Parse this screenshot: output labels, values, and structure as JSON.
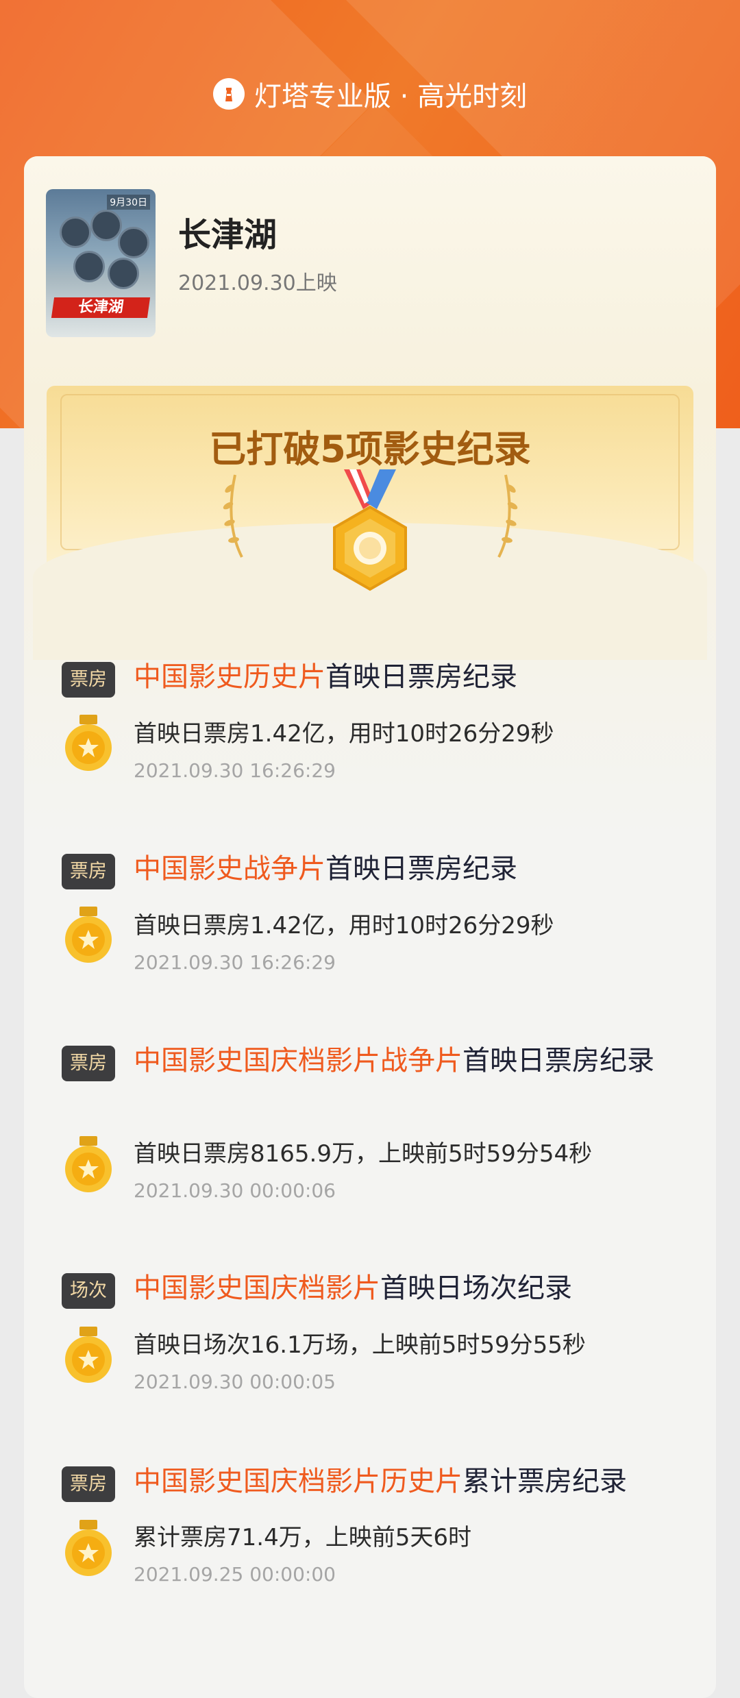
{
  "header": {
    "brand": "灯塔专业版 · 高光时刻"
  },
  "movie": {
    "title": "长津湖",
    "date": "2021.09.30上映",
    "poster_tag": "9月30日",
    "poster_title": "长津湖"
  },
  "banner": {
    "title": "已打破5项影史纪录"
  },
  "colors": {
    "accent": "#ef5a1e",
    "brand_orange": "#f0621f",
    "tag_bg": "#3d3d3f",
    "gold": "#f5b21f"
  },
  "records": [
    {
      "tag": "票房",
      "highlight": "中国影史历史片",
      "rest": "首映日票房纪录",
      "desc": "首映日票房1.42亿，用时10时26分29秒",
      "time": "2021.09.30 16:26:29"
    },
    {
      "tag": "票房",
      "highlight": "中国影史战争片",
      "rest": "首映日票房纪录",
      "desc": "首映日票房1.42亿，用时10时26分29秒",
      "time": "2021.09.30 16:26:29"
    },
    {
      "tag": "票房",
      "highlight": "中国影史国庆档影片战争片",
      "rest": "首映日票房纪录",
      "desc": "首映日票房8165.9万，上映前5时59分54秒",
      "time": "2021.09.30 00:00:06"
    },
    {
      "tag": "场次",
      "highlight": "中国影史国庆档影片",
      "rest": "首映日场次纪录",
      "desc": "首映日场次16.1万场，上映前5时59分55秒",
      "time": "2021.09.30 00:00:05"
    },
    {
      "tag": "票房",
      "highlight": "中国影史国庆档影片历史片",
      "rest": "累计票房纪录",
      "desc": "累计票房71.4万，上映前5天6时",
      "time": "2021.09.25 00:00:00"
    }
  ]
}
